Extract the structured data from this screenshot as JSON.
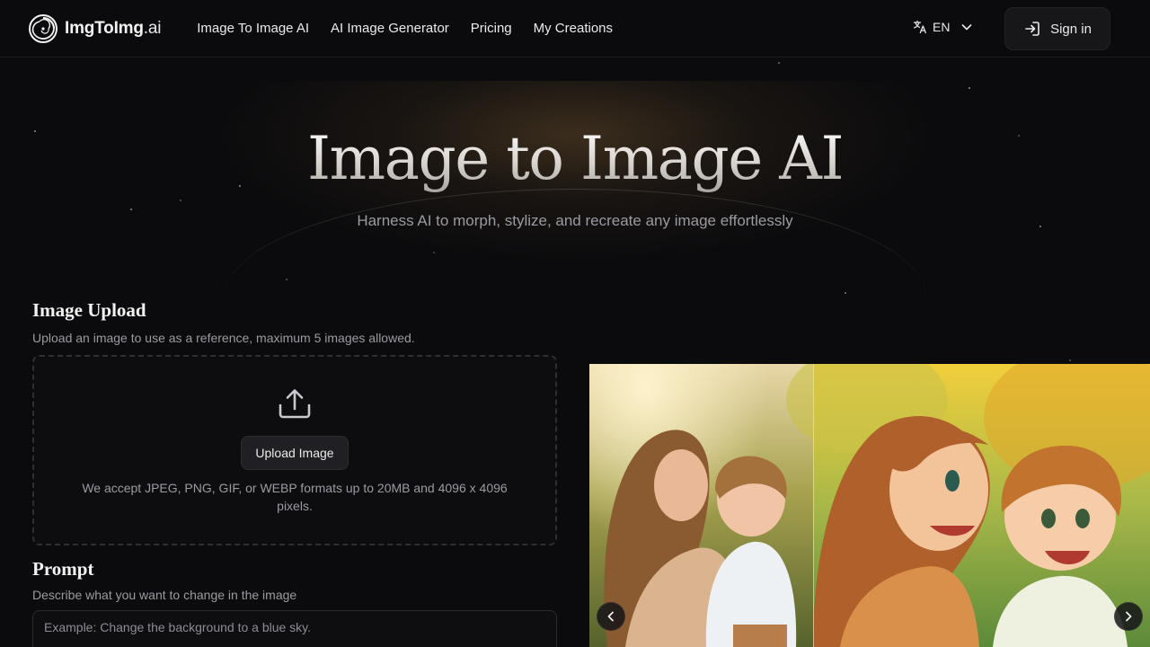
{
  "header": {
    "logo_name": "ImgToImg",
    "logo_suffix": ".ai",
    "nav": [
      {
        "label": "Image To Image AI"
      },
      {
        "label": "AI Image Generator"
      },
      {
        "label": "Pricing"
      },
      {
        "label": "My Creations"
      }
    ],
    "language": "EN",
    "signin_label": "Sign in"
  },
  "hero": {
    "title": "Image to Image AI",
    "subtitle": "Harness AI to morph, stylize, and recreate any image effortlessly"
  },
  "upload": {
    "title": "Image Upload",
    "description": "Upload an image to use as a reference, maximum 5 images allowed.",
    "button_label": "Upload Image",
    "accept_text": "We accept JPEG, PNG, GIF, or WEBP formats up to 20MB and 4096 x 4096 pixels."
  },
  "prompt": {
    "title": "Prompt",
    "description": "Describe what you want to change in the image",
    "placeholder": "Example: Change the background to a blue sky."
  },
  "carousel": {
    "prev_icon": "chevron-left-icon",
    "next_icon": "chevron-right-icon"
  },
  "colors": {
    "background": "#0b0b0d",
    "header_border": "#1c1c20",
    "muted_text": "#9a9aa2",
    "dashed_border": "#2e2e33"
  }
}
